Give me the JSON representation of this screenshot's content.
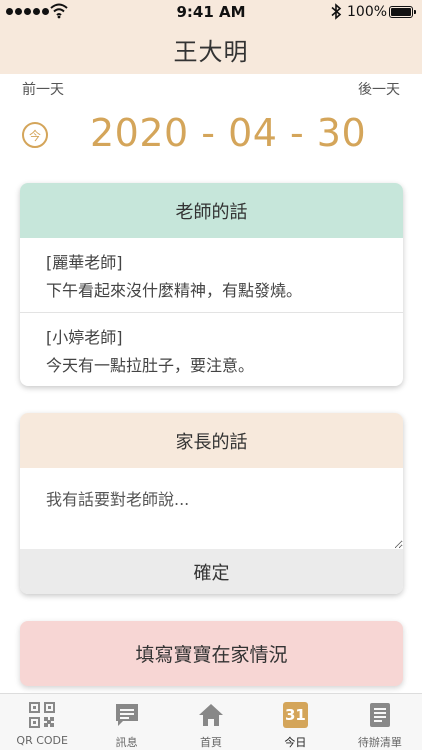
{
  "status_bar": {
    "time": "9:41 AM",
    "battery": "100%"
  },
  "header": {
    "title": "王大明"
  },
  "nav": {
    "prev_day": "前一天",
    "next_day": "後一天",
    "today_label": "今"
  },
  "date": {
    "display": "2020 - 04 - 30"
  },
  "teacher_card": {
    "title": "老師的話",
    "messages": [
      {
        "author": "[麗華老師]",
        "text": "下午看起來沒什麼精神，有點發燒。"
      },
      {
        "author": "[小婷老師]",
        "text": "今天有一點拉肚子，要注意。"
      }
    ]
  },
  "parent_card": {
    "title": "家長的話",
    "input_placeholder": "我有話要對老師說...",
    "input_value": "",
    "confirm_label": "確定"
  },
  "home_status_button": {
    "label": "填寫寶寶在家情況"
  },
  "tab_bar": {
    "tabs": [
      {
        "label": "QR CODE",
        "icon": "qr-code-icon"
      },
      {
        "label": "訊息",
        "icon": "message-icon"
      },
      {
        "label": "首頁",
        "icon": "home-icon"
      },
      {
        "label": "今日",
        "icon": "calendar-icon",
        "badge": "31",
        "active": true
      },
      {
        "label": "待辦清單",
        "icon": "todo-list-icon"
      }
    ]
  },
  "colors": {
    "header_bg": "#f7e9dc",
    "accent": "#d4a55a",
    "teacher_head": "#c6e6da",
    "home_button_bg": "#f7d6d4",
    "confirm_bg": "#ebebeb"
  }
}
